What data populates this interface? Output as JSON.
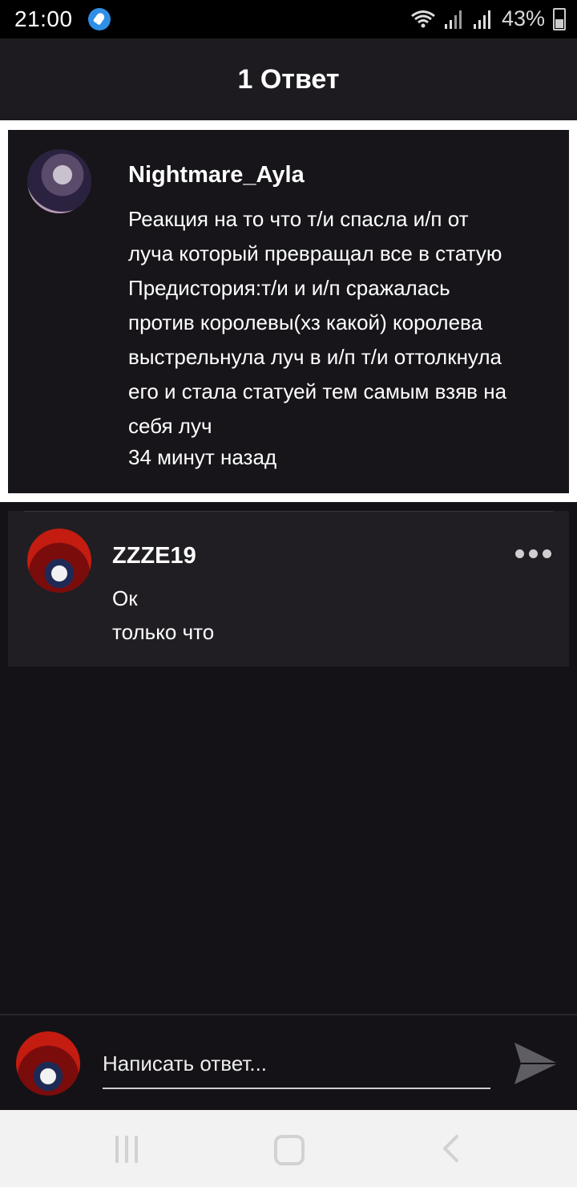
{
  "status_bar": {
    "time": "21:00",
    "app_icon": "rocket-icon",
    "icons": [
      "wifi-icon",
      "signal-icon",
      "signal-icon",
      "battery-icon"
    ],
    "battery_percent": "43%"
  },
  "header": {
    "title": "1 Ответ"
  },
  "post": {
    "author": "Nightmare_Ayla",
    "body": "Реакция на то что т/и спасла и/п от\nлуча который превращал все в статую\nПредистория:т/и и и/п сражалась\nпротив королевы(хз какой) королева\nвыстрельнула луч в и/п т/и оттолкнула\nего и стала статуей тем самым взяв на\nсебя луч",
    "time": "34 минут назад"
  },
  "reply": {
    "author": "ZZZE19",
    "text": "Ок",
    "time": "только что",
    "more_icon": "more-horizontal-icon"
  },
  "compose": {
    "placeholder": "Написать ответ...",
    "send_icon": "send-icon"
  },
  "nav": {
    "recent_icon": "recent-apps-icon",
    "home_icon": "home-icon",
    "back_icon": "back-icon"
  },
  "colors": {
    "background": "#141216",
    "header": "#1d1b1f",
    "card": "#171519",
    "reply_card": "#201e23",
    "text": "#ffffff"
  }
}
